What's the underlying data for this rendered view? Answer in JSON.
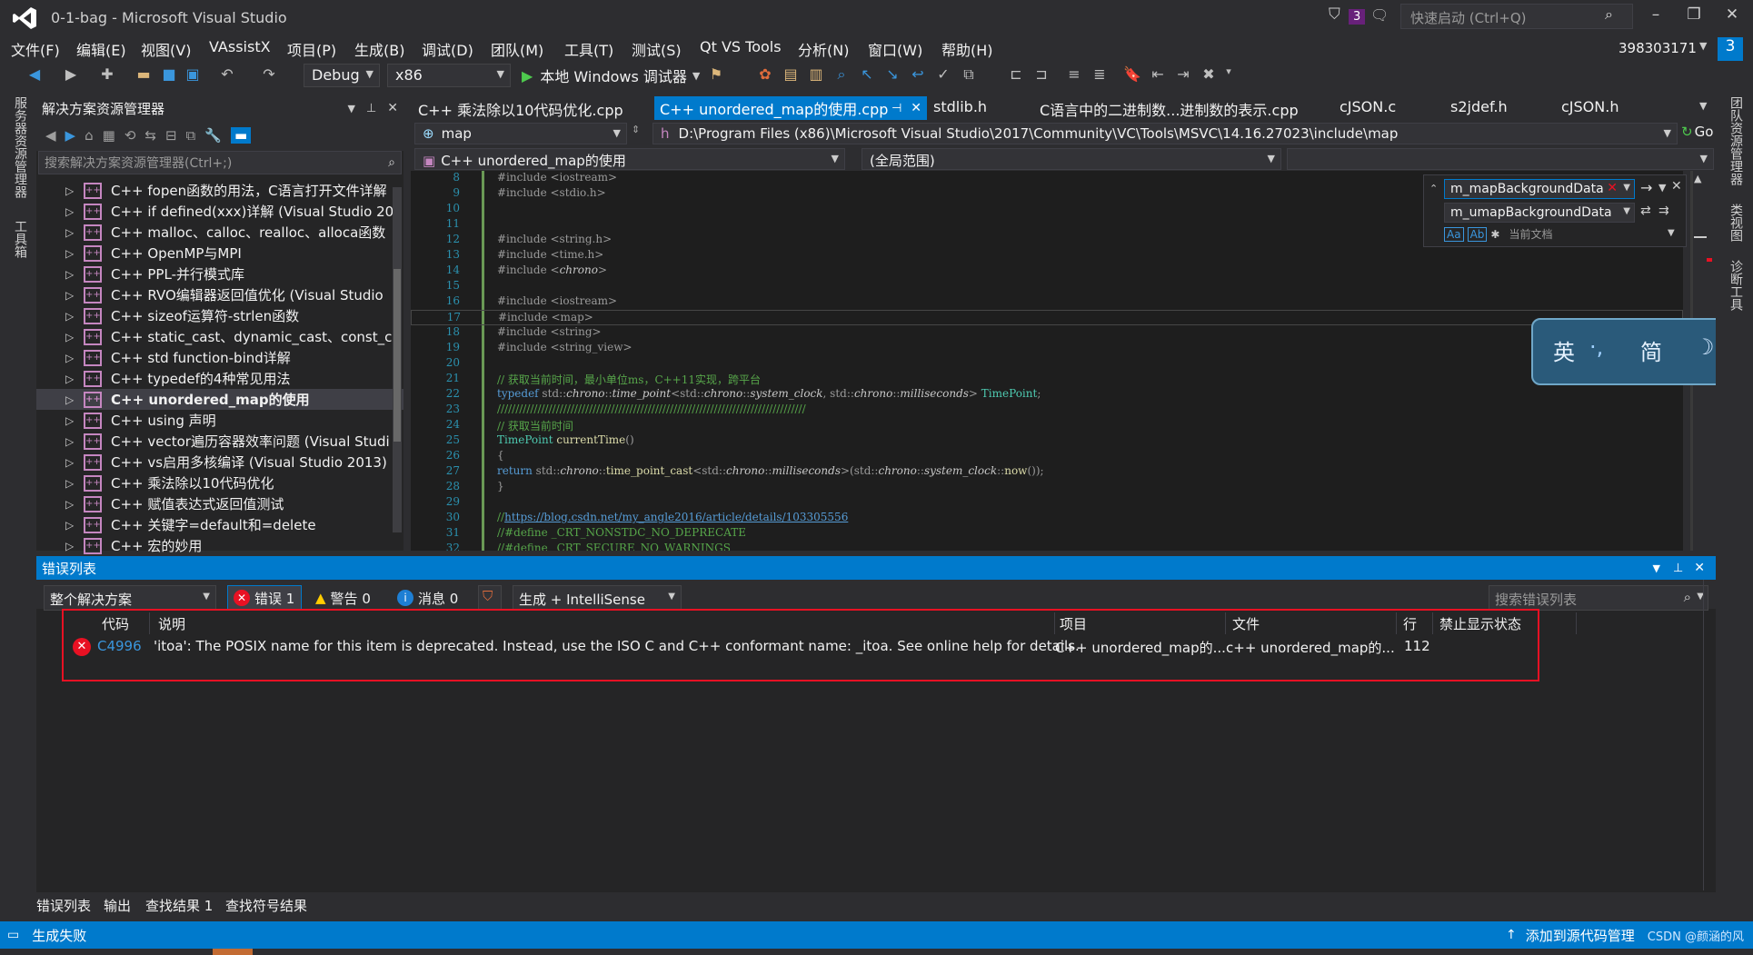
{
  "window": {
    "title": "0-1-bag - Microsoft Visual Studio",
    "notification_count": "3",
    "quick_launch_placeholder": "快速启动 (Ctrl+Q)",
    "user": "398303171",
    "user_badge": "3"
  },
  "menu": [
    "文件(F)",
    "编辑(E)",
    "视图(V)",
    "VAssistX",
    "项目(P)",
    "生成(B)",
    "调试(D)",
    "团队(M)",
    "工具(T)",
    "测试(S)",
    "Qt VS Tools",
    "分析(N)",
    "窗口(W)",
    "帮助(H)"
  ],
  "toolbar": {
    "config": "Debug",
    "platform": "x86",
    "debugger": "本地 Windows 调试器"
  },
  "left_strip": {
    "server_explorer": "服务器资源管理器",
    "toolbox": "工具箱"
  },
  "solution_explorer": {
    "title": "解决方案资源管理器",
    "search_placeholder": "搜索解决方案资源管理器(Ctrl+;)",
    "items": [
      {
        "label": "C++ fopen函数的用法，C语言打开文件详解",
        "selected": false
      },
      {
        "label": "C++ if defined(xxx)详解 (Visual Studio 20",
        "selected": false
      },
      {
        "label": "C++ malloc、calloc、realloc、alloca函数",
        "selected": false
      },
      {
        "label": "C++ OpenMP与MPI",
        "selected": false
      },
      {
        "label": "C++ PPL-并行模式库",
        "selected": false
      },
      {
        "label": "C++ RVO编辑器返回值优化 (Visual Studio",
        "selected": false
      },
      {
        "label": "C++ sizeof运算符-strlen函数",
        "selected": false
      },
      {
        "label": "C++ static_cast、dynamic_cast、const_c",
        "selected": false
      },
      {
        "label": "C++ std function-bind详解",
        "selected": false
      },
      {
        "label": "C++ typedef的4种常见用法",
        "selected": false
      },
      {
        "label": "C++ unordered_map的使用",
        "selected": true
      },
      {
        "label": "C++ using 声明",
        "selected": false
      },
      {
        "label": "C++ vector遍历容器效率问题 (Visual Studi",
        "selected": false
      },
      {
        "label": "C++ vs启用多核编译 (Visual Studio 2013)",
        "selected": false
      },
      {
        "label": "C++ 乘法除以10代码优化",
        "selected": false
      },
      {
        "label": "C++ 赋值表达式返回值测试",
        "selected": false
      },
      {
        "label": "C++ 关键字=default和=delete",
        "selected": false
      },
      {
        "label": "C++ 宏的妙用",
        "selected": false
      }
    ]
  },
  "editor": {
    "tabs": [
      "C++ 乘法除以10代码优化.cpp",
      "C++ unordered_map的使用.cpp",
      "stdlib.h",
      "C语言中的二进制数...进制数的表示.cpp",
      "cJSON.c",
      "s2jdef.h",
      "cJSON.h"
    ],
    "active_tab": 1,
    "nav_symbol": "map",
    "nav_path": "D:\\Program Files (x86)\\Microsoft Visual Studio\\2017\\Community\\VC\\Tools\\MSVC\\14.16.27023\\include\\map",
    "go_label": "Go",
    "scope_project": "C++ unordered_map的使用",
    "scope_global": "(全局范围)",
    "find_text": "m_mapBackgroundData",
    "replace_text": "m_umapBackgroundData",
    "find_scope": "当前文档",
    "lines": [
      {
        "n": "8",
        "t": "#include <iostream>"
      },
      {
        "n": "9",
        "t": "#include <stdio.h>"
      },
      {
        "n": "10",
        "t": ""
      },
      {
        "n": "11",
        "t": ""
      },
      {
        "n": "12",
        "t": "#include <string.h>"
      },
      {
        "n": "13",
        "t": "#include <time.h>"
      },
      {
        "n": "14",
        "t": "#include <chrono>"
      },
      {
        "n": "15",
        "t": ""
      },
      {
        "n": "16",
        "t": "#include <iostream>"
      },
      {
        "n": "17",
        "t": "#include <map>"
      },
      {
        "n": "18",
        "t": "#include <string>"
      },
      {
        "n": "19",
        "t": "#include <string_view>"
      },
      {
        "n": "20",
        "t": ""
      },
      {
        "n": "21",
        "t": "// 获取当前时间，最小单位ms，C++11实现，跨平台"
      },
      {
        "n": "22",
        "t": "typedef std::chrono::time_point<std::chrono::system_clock, std::chrono::milliseconds> TimePoint;"
      },
      {
        "n": "23",
        "t": "////////////////////////////////////////////////////////////////////////////////////"
      },
      {
        "n": "24",
        "t": "// 获取当前时间"
      },
      {
        "n": "25",
        "t": "TimePoint currentTime()"
      },
      {
        "n": "26",
        "t": "{"
      },
      {
        "n": "27",
        "t": "    return std::chrono::time_point_cast<std::chrono::milliseconds>(std::chrono::system_clock::now());"
      },
      {
        "n": "28",
        "t": "}"
      },
      {
        "n": "29",
        "t": ""
      },
      {
        "n": "30",
        "t": "//https://blog.csdn.net/my_angle2016/article/details/103305556"
      },
      {
        "n": "31",
        "t": "//#define _CRT_NONSTDC_NO_DEPRECATE"
      },
      {
        "n": "32",
        "t": "//#define _CRT_SECURE_NO_WARNINGS"
      }
    ]
  },
  "ime": {
    "mode1": "英",
    "mode2": "简"
  },
  "right_strip": {
    "team": "团队资源管理器",
    "class_view": "类视图",
    "diag": "诊断工具"
  },
  "error_list": {
    "title": "错误列表",
    "scope": "整个解决方案",
    "errors_label": "错误 1",
    "warnings_label": "警告 0",
    "messages_label": "消息 0",
    "build_filter": "生成 + IntelliSense",
    "search_placeholder": "搜索错误列表",
    "columns": [
      "代码",
      "说明",
      "项目",
      "文件",
      "行",
      "禁止显示状态"
    ],
    "rows": [
      {
        "code": "C4996",
        "description": "'itoa': The POSIX name for this item is deprecated. Instead, use the ISO C and C++ conformant name: _itoa. See online help for details.",
        "project": "C++ unordered_map的...",
        "file": "c++ unordered_map的...",
        "line": "112",
        "suppress": ""
      }
    ]
  },
  "bottom_tabs": [
    "错误列表",
    "输出",
    "查找结果 1",
    "查找符号结果"
  ],
  "status": {
    "left": "生成失败",
    "right": "添加到源代码管理",
    "watermark": "CSDN @颜涵的风"
  },
  "colors": {
    "accent": "#007acc",
    "error": "#e81123",
    "bg": "#2d2d30"
  }
}
